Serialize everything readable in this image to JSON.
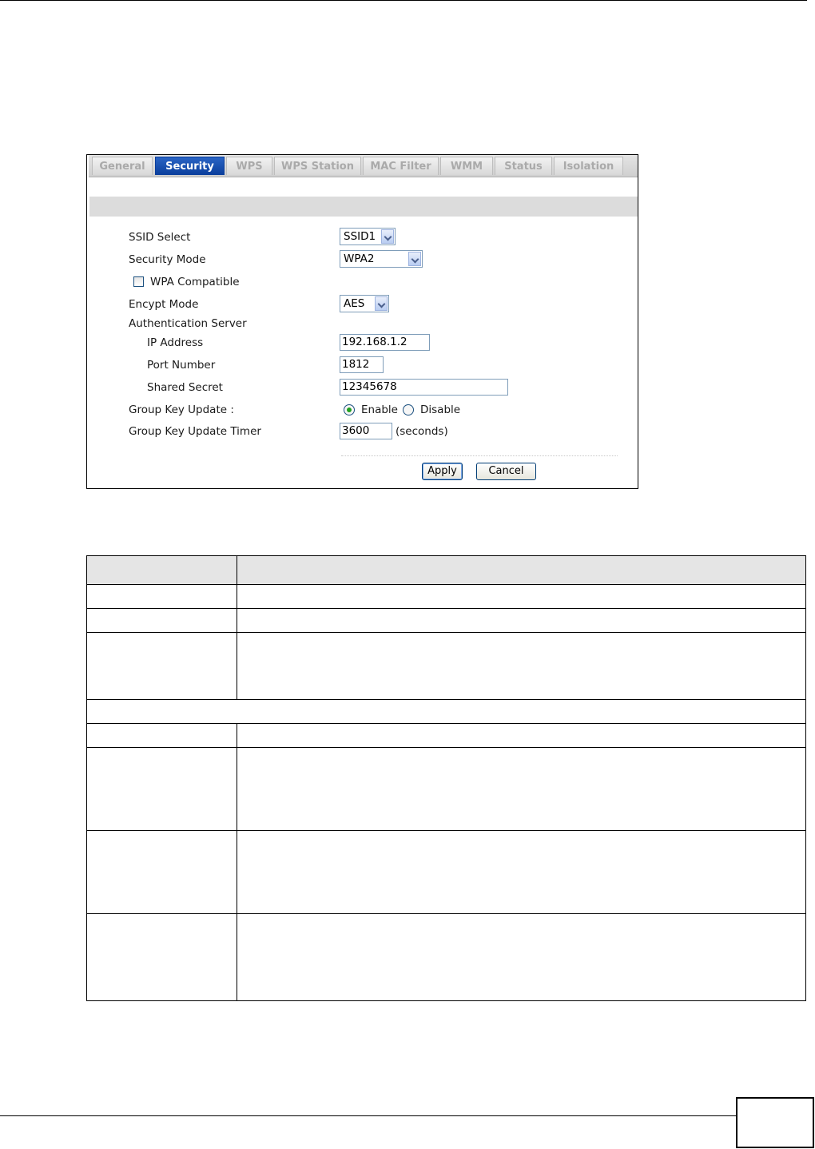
{
  "tabs": [
    {
      "label": "General",
      "active": false
    },
    {
      "label": "Security",
      "active": true
    },
    {
      "label": "WPS",
      "active": false
    },
    {
      "label": "WPS Station",
      "active": false
    },
    {
      "label": "MAC Filter",
      "active": false
    },
    {
      "label": "WMM",
      "active": false
    },
    {
      "label": "Status",
      "active": false
    },
    {
      "label": "Isolation",
      "active": false
    }
  ],
  "form": {
    "ssid_select": {
      "label": "SSID Select",
      "value": "SSID1"
    },
    "security_mode": {
      "label": "Security Mode",
      "value": "WPA2"
    },
    "wpa_compatible": {
      "label": "WPA Compatible",
      "checked": false
    },
    "encrypt_mode": {
      "label": "Encypt Mode",
      "value": "AES"
    },
    "auth_server": {
      "label": "Authentication Server"
    },
    "ip_address": {
      "label": "IP Address",
      "value": "192.168.1.2"
    },
    "port_number": {
      "label": "Port Number",
      "value": "1812"
    },
    "shared_secret": {
      "label": "Shared Secret",
      "value": "12345678"
    },
    "group_key_update": {
      "label": "Group Key Update :",
      "enable_label": "Enable",
      "disable_label": "Disable",
      "selected": "Enable"
    },
    "group_key_timer": {
      "label": "Group Key Update Timer",
      "value": "3600",
      "unit": "(seconds)"
    }
  },
  "buttons": {
    "apply": "Apply",
    "cancel": "Cancel"
  },
  "colors": {
    "active_tab": "#1650b3",
    "section_bar": "#dcdcdc",
    "table_header": "#e5e5e5"
  }
}
